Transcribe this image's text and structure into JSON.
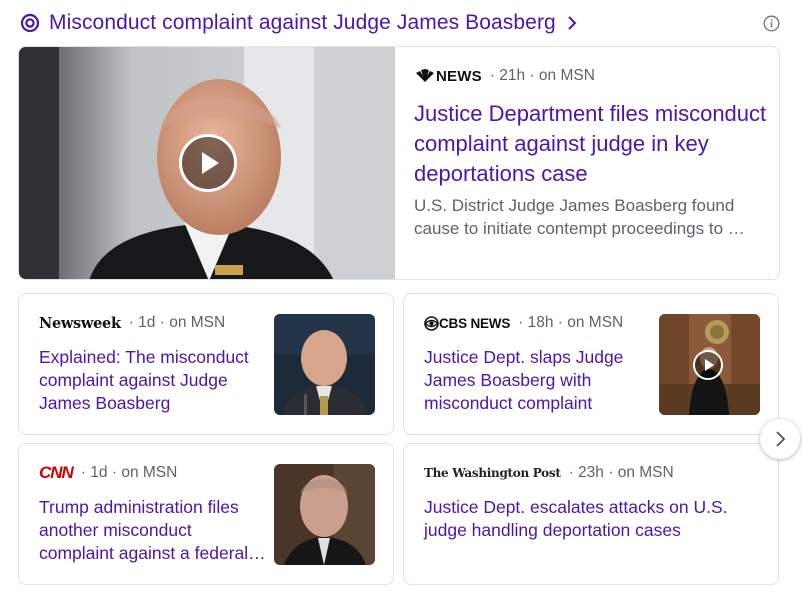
{
  "header": {
    "title": "Misconduct complaint against Judge James Boasberg",
    "ring_icon": "circle-ring-icon",
    "chevron_icon": "chevron-right-icon",
    "info_icon": "info-icon"
  },
  "colors": {
    "link": "#4a16b0",
    "meta_text": "#5f6368",
    "card_border": "#e3e3e3",
    "cnn_red": "#cc0000"
  },
  "featured": {
    "source": "NEWS",
    "source_logo": "nbc-peacock-logo",
    "meta": "· 21h · on MSN",
    "headline": "Justice Department files misconduct complaint against judge in key deportations case",
    "snippet": "U.S. District Judge James Boasberg found cause to initiate contempt proceedings to …",
    "has_video": true
  },
  "cards": [
    {
      "source": "Newsweek",
      "meta": "· 1d · on MSN",
      "headline": "Explained: The misconduct complaint against Judge James Boasberg",
      "has_video": false
    },
    {
      "source": "CBS NEWS",
      "source_logo": "cbs-eye-logo",
      "meta": "· 18h · on MSN",
      "headline": "Justice Dept. slaps Judge James Boasberg with misconduct complaint",
      "has_video": true
    },
    {
      "source": "CNN",
      "meta": "· 1d · on MSN",
      "headline": "Trump administration files another misconduct complaint against a federal…",
      "has_video": false
    },
    {
      "source": "The Washington Post",
      "meta": "· 23h · on MSN",
      "headline": "Justice Dept. escalates attacks on U.S. judge handling deportation cases",
      "has_video": false
    }
  ],
  "carousel": {
    "next_icon": "chevron-right-icon"
  }
}
